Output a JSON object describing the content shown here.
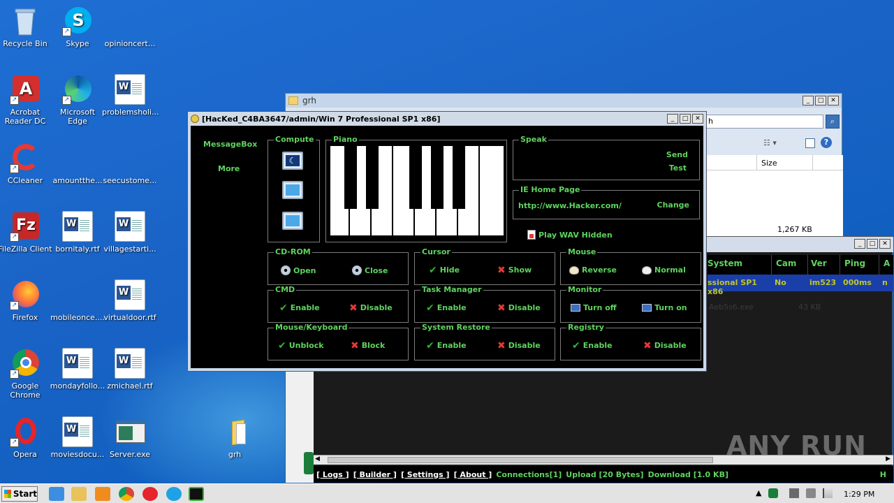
{
  "desktop": {
    "icons": [
      {
        "label": "Recycle Bin",
        "icon": "recycle-bin-icon"
      },
      {
        "label": "Skype",
        "icon": "skype-icon"
      },
      {
        "label": "opinioncert...",
        "icon": "blank-file-icon"
      },
      {
        "label": "Acrobat Reader DC",
        "icon": "acrobat-icon"
      },
      {
        "label": "Microsoft Edge",
        "icon": "edge-icon"
      },
      {
        "label": "problemsholi...",
        "icon": "word-doc-icon"
      },
      {
        "label": "CCleaner",
        "icon": "ccleaner-icon"
      },
      {
        "label": "amountthe...",
        "icon": "blank-file-icon"
      },
      {
        "label": "seecustome...",
        "icon": "blank-file-icon"
      },
      {
        "label": "FileZilla Client",
        "icon": "filezilla-icon"
      },
      {
        "label": "bornitaly.rtf",
        "icon": "word-doc-icon"
      },
      {
        "label": "villagestarti...",
        "icon": "word-doc-icon"
      },
      {
        "label": "Firefox",
        "icon": "firefox-icon"
      },
      {
        "label": "mobileonce....",
        "icon": "blank-file-icon"
      },
      {
        "label": "virtualdoor.rtf",
        "icon": "word-doc-icon"
      },
      {
        "label": "Google Chrome",
        "icon": "chrome-icon"
      },
      {
        "label": "mondayfollo...",
        "icon": "word-doc-icon"
      },
      {
        "label": "zmichael.rtf",
        "icon": "word-doc-icon"
      },
      {
        "label": "Opera",
        "icon": "opera-icon"
      },
      {
        "label": "moviesdocu...",
        "icon": "word-doc-icon"
      },
      {
        "label": "Server.exe",
        "icon": "exe-icon"
      },
      {
        "label": "grh",
        "icon": "folder-icon"
      }
    ]
  },
  "explorer": {
    "title": "grh",
    "search_tail": "h",
    "column_size": "Size",
    "file_size": "1,267 KB"
  },
  "njrat": {
    "columns": [
      "System",
      "Cam",
      "Ver",
      "Ping",
      "A"
    ],
    "row": [
      "ssional SP1 x86",
      "No",
      "im523",
      "000ms",
      "n"
    ],
    "ghost_text": "Aeb5s6.exe",
    "ghost_size": "43 KB",
    "status_links": [
      "[ Logs ]",
      "[ Builder ]",
      "[ Settings ]",
      "[ About ]"
    ],
    "status_connections": "Connections[1]",
    "status_upload": "Upload [20 Bytes]",
    "status_download": "Download [1.0 KB]",
    "status_end": "H"
  },
  "rat": {
    "title": "[HacKed_C4BA3647/admin/Win 7 Professional SP1 x86]",
    "left_menu": [
      "MessageBox",
      "More"
    ],
    "compute_label": "Compute",
    "piano_label": "Piano",
    "speak": {
      "label": "Speak",
      "send": "Send",
      "test": "Test"
    },
    "ie": {
      "label": "IE Home Page",
      "url": "http://www.Hacker.com/",
      "change": "Change"
    },
    "wav": "Play WAV Hidden",
    "groups": [
      {
        "title": "CD-ROM",
        "a": "Open",
        "b": "Close"
      },
      {
        "title": "Cursor",
        "a": "Hide",
        "b": "Show"
      },
      {
        "title": "Mouse",
        "a": "Reverse",
        "b": "Normal"
      },
      {
        "title": "CMD",
        "a": "Enable",
        "b": "Disable"
      },
      {
        "title": "Task Manager",
        "a": "Enable",
        "b": "Disable"
      },
      {
        "title": "Monitor",
        "a": "Turn off",
        "b": "Turn on"
      },
      {
        "title": "Mouse/Keyboard",
        "a": "Unblock",
        "b": "Block"
      },
      {
        "title": "System Restore",
        "a": "Enable",
        "b": "Disable"
      },
      {
        "title": "Registry",
        "a": "Enable",
        "b": "Disable"
      }
    ]
  },
  "taskbar": {
    "start": "Start",
    "clock": "1:29 PM"
  },
  "watermark": "ANY RUN"
}
